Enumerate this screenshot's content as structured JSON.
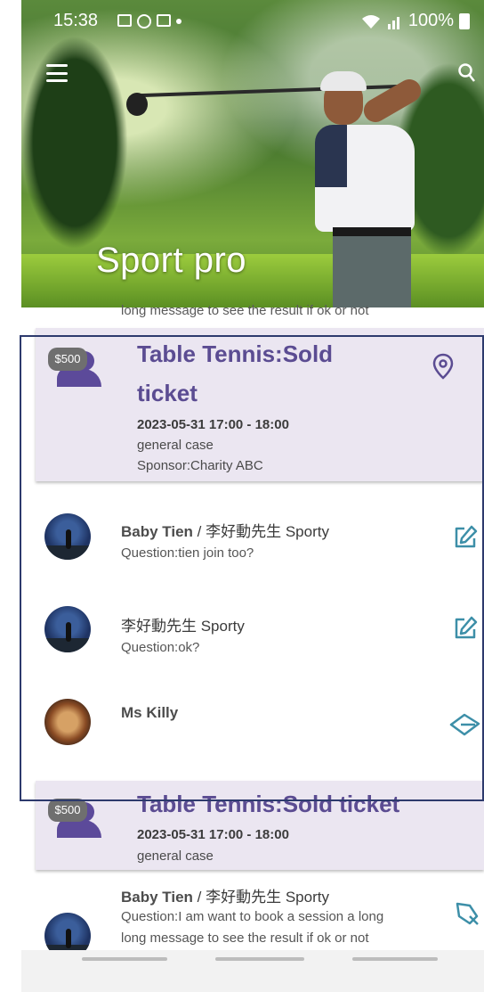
{
  "status_bar": {
    "time": "15:38",
    "battery": "100%"
  },
  "hero": {
    "title": "Sport pro"
  },
  "partial_message": "long message to see the result if ok or not",
  "events": [
    {
      "price": "$500",
      "title_line1": "Table Tennis:Sold",
      "title_line2": "ticket",
      "date": "2023-05-31 17:00 - 18:00",
      "category": "general case",
      "sponsor": "Sponsor:Charity ABC"
    },
    {
      "price": "$500",
      "title": "Table Tennis:Sold ticket",
      "date": "2023-05-31 17:00 - 18:00",
      "category": "general case"
    }
  ],
  "messages": [
    {
      "name": "Baby Tien",
      "sep": " / ",
      "name2": "李好動先生 Sporty",
      "question": "Question:tien join too?"
    },
    {
      "name": "李好動先生 Sporty",
      "question": "Question:ok?"
    },
    {
      "name": "Ms Killy"
    },
    {
      "name": "Baby Tien",
      "sep": " / ",
      "name2": "李好動先生 Sporty",
      "question_line1": "Question:I am want to book a session a long",
      "question_line2": "long message to see the result if ok or not"
    }
  ],
  "colors": {
    "accent": "#5b4c92",
    "card_bg": "#ebe6f1",
    "icon_teal": "#3d8fa8"
  }
}
